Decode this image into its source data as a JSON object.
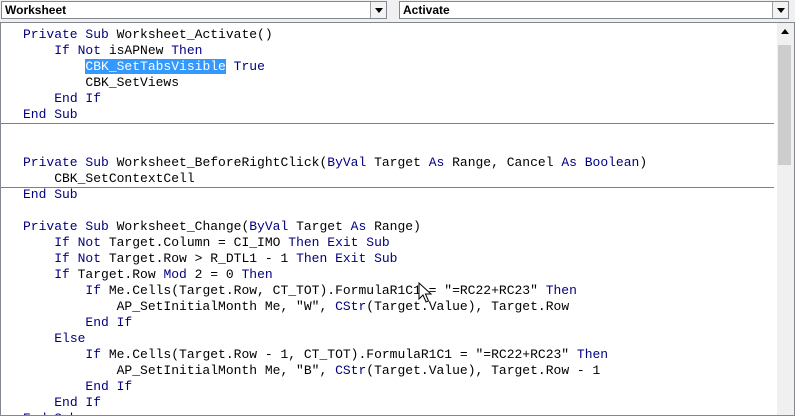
{
  "object_combo": {
    "value": "Worksheet"
  },
  "procedure_combo": {
    "value": "Activate"
  },
  "code": {
    "l1": [
      {
        "t": "Private Sub ",
        "k": true
      },
      {
        "t": "Worksheet_Activate()"
      }
    ],
    "l2": [
      {
        "t": "    "
      },
      {
        "t": "If Not ",
        "k": true
      },
      {
        "t": "isAPNew "
      },
      {
        "t": "Then",
        "k": true
      }
    ],
    "l3": [
      {
        "t": "        "
      },
      {
        "t": "CBK_SetTabsVisible",
        "s": true
      },
      {
        "t": " "
      },
      {
        "t": "True",
        "k": true
      }
    ],
    "l4": [
      {
        "t": "        CBK_SetViews"
      }
    ],
    "l5": [
      {
        "t": "    "
      },
      {
        "t": "End If",
        "k": true
      }
    ],
    "l6": [
      {
        "t": "End Sub",
        "k": true
      }
    ],
    "l7": [
      {
        "t": "Private Sub ",
        "k": true
      },
      {
        "t": "Worksheet_BeforeRightClick("
      },
      {
        "t": "ByVal ",
        "k": true
      },
      {
        "t": "Target "
      },
      {
        "t": "As ",
        "k": true
      },
      {
        "t": "Range, Cancel "
      },
      {
        "t": "As Boolean",
        "k": true
      },
      {
        "t": ")"
      }
    ],
    "l8": [
      {
        "t": "    CBK_SetContextCell"
      }
    ],
    "l9": [
      {
        "t": "End Sub",
        "k": true
      }
    ],
    "l10": [
      {
        "t": "Private Sub ",
        "k": true
      },
      {
        "t": "Worksheet_Change("
      },
      {
        "t": "ByVal ",
        "k": true
      },
      {
        "t": "Target "
      },
      {
        "t": "As ",
        "k": true
      },
      {
        "t": "Range)"
      }
    ],
    "l11": [
      {
        "t": "    "
      },
      {
        "t": "If Not ",
        "k": true
      },
      {
        "t": "Target.Column = CI_IMO "
      },
      {
        "t": "Then Exit Sub",
        "k": true
      }
    ],
    "l12": [
      {
        "t": "    "
      },
      {
        "t": "If Not ",
        "k": true
      },
      {
        "t": "Target.Row > R_DTL1 - 1 "
      },
      {
        "t": "Then Exit Sub",
        "k": true
      }
    ],
    "l13": [
      {
        "t": "    "
      },
      {
        "t": "If ",
        "k": true
      },
      {
        "t": "Target.Row "
      },
      {
        "t": "Mod ",
        "k": true
      },
      {
        "t": "2 = 0 "
      },
      {
        "t": "Then",
        "k": true
      }
    ],
    "l14": [
      {
        "t": "        "
      },
      {
        "t": "If ",
        "k": true
      },
      {
        "t": "Me.Cells(Target.Row, CT_TOT).FormulaR1C1 = \"=RC22+RC23\" "
      },
      {
        "t": "Then",
        "k": true
      }
    ],
    "l15": [
      {
        "t": "            AP_SetInitialMonth Me, \"W\", "
      },
      {
        "t": "CStr",
        "k": true
      },
      {
        "t": "(Target.Value), Target.Row"
      }
    ],
    "l16": [
      {
        "t": "        "
      },
      {
        "t": "End If",
        "k": true
      }
    ],
    "l17": [
      {
        "t": "    "
      },
      {
        "t": "Else",
        "k": true
      }
    ],
    "l18": [
      {
        "t": "        "
      },
      {
        "t": "If ",
        "k": true
      },
      {
        "t": "Me.Cells(Target.Row - 1, CT_TOT).FormulaR1C1 = \"=RC22+RC23\" "
      },
      {
        "t": "Then",
        "k": true
      }
    ],
    "l19": [
      {
        "t": "            AP_SetInitialMonth Me, \"B\", "
      },
      {
        "t": "CStr",
        "k": true
      },
      {
        "t": "(Target.Value), Target.Row - 1"
      }
    ],
    "l20": [
      {
        "t": "        "
      },
      {
        "t": "End If",
        "k": true
      }
    ],
    "l21": [
      {
        "t": "    "
      },
      {
        "t": "End If",
        "k": true
      }
    ],
    "l22": [
      {
        "t": "End Sub",
        "k": true
      }
    ]
  },
  "colors": {
    "keyword": "#00007f",
    "selection": "#3399ff"
  },
  "icons": {
    "dropdown": "chevron-down-icon",
    "cursor": "mouse-pointer-icon"
  }
}
